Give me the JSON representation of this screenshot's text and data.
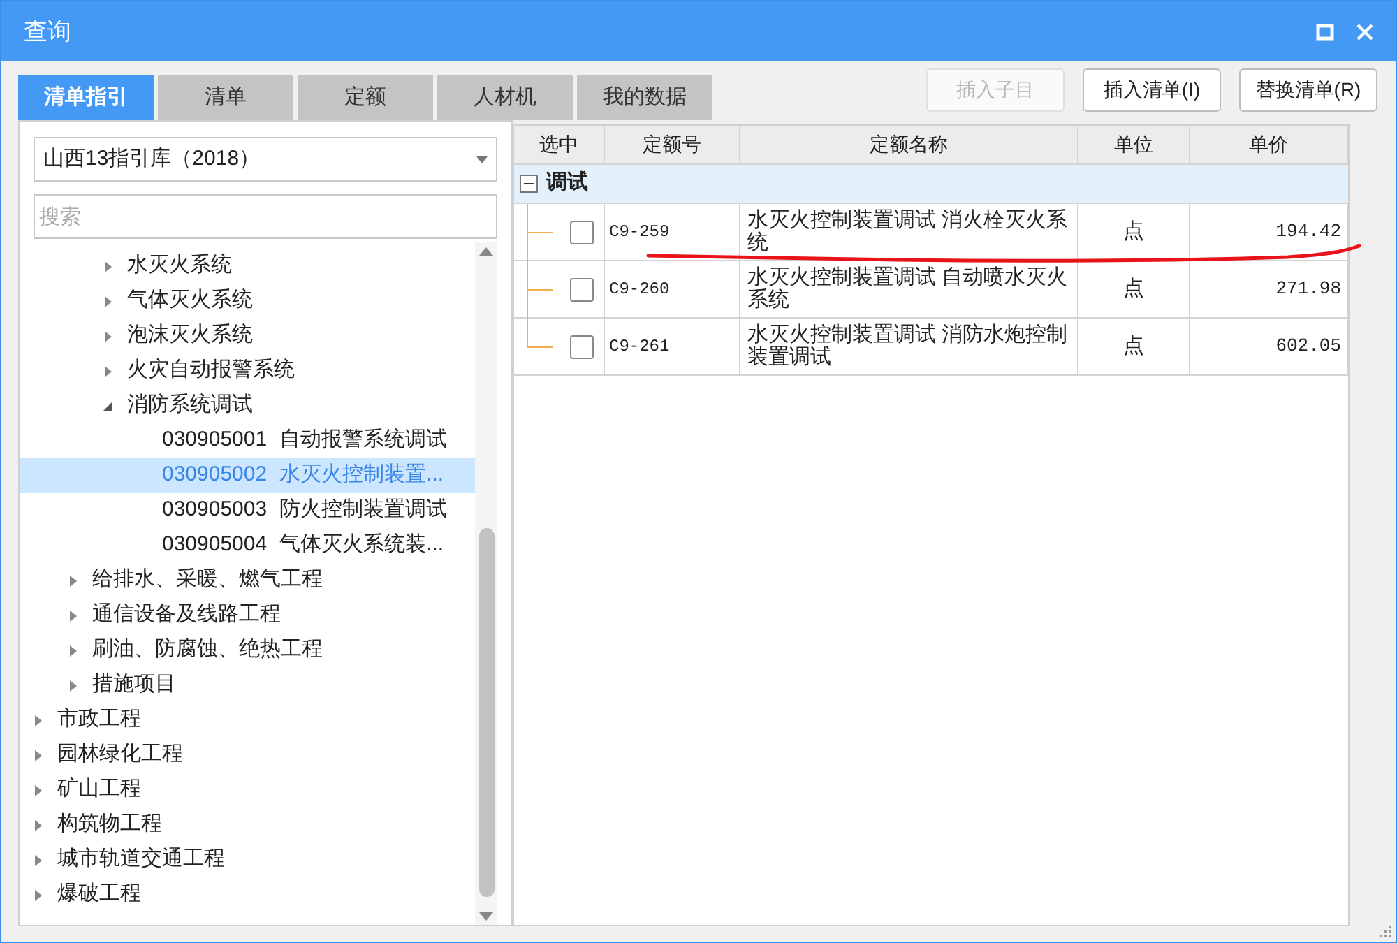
{
  "window": {
    "title": "查询"
  },
  "tabs": [
    {
      "label": "清单指引",
      "selected": true
    },
    {
      "label": "清单",
      "selected": false
    },
    {
      "label": "定额",
      "selected": false
    },
    {
      "label": "人材机",
      "selected": false
    },
    {
      "label": "我的数据",
      "selected": false
    }
  ],
  "buttons": [
    {
      "label": "插入子目",
      "disabled": true
    },
    {
      "label": "插入清单(I)",
      "disabled": false
    },
    {
      "label": "替换清单(R)",
      "disabled": false
    }
  ],
  "library_select": {
    "value": "山西13指引库（2018）"
  },
  "search": {
    "placeholder": "搜索"
  },
  "tree": {
    "items": [
      {
        "children": [
          {
            "children": [
              {
                "label": "水灭火系统",
                "expanded": false,
                "selected": false
              },
              {
                "label": "气体灭火系统",
                "expanded": false,
                "selected": false
              },
              {
                "label": "泡沫灭火系统",
                "expanded": false,
                "selected": false
              },
              {
                "label": "火灾自动报警系统",
                "expanded": false,
                "selected": false
              },
              {
                "label": "消防系统调试",
                "expanded": true,
                "selected": false,
                "children": [
                  {
                    "code": "030905001",
                    "label": "自动报警系统调试",
                    "selected": false
                  },
                  {
                    "code": "030905002",
                    "label": "水灭火控制装置...",
                    "selected": true
                  },
                  {
                    "code": "030905003",
                    "label": "防火控制装置调试",
                    "selected": false
                  },
                  {
                    "code": "030905004",
                    "label": "气体灭火系统装...",
                    "selected": false
                  }
                ]
              }
            ]
          },
          {
            "label": "给排水、采暖、燃气工程",
            "expanded": false,
            "selected": false
          },
          {
            "label": "通信设备及线路工程",
            "expanded": false,
            "selected": false
          },
          {
            "label": "刷油、防腐蚀、绝热工程",
            "expanded": false,
            "selected": false
          },
          {
            "label": "措施项目",
            "expanded": false,
            "selected": false
          }
        ]
      },
      {
        "label": "市政工程",
        "expanded": false,
        "selected": false
      },
      {
        "label": "园林绿化工程",
        "expanded": false,
        "selected": false
      },
      {
        "label": "矿山工程",
        "expanded": false,
        "selected": false
      },
      {
        "label": "构筑物工程",
        "expanded": false,
        "selected": false
      },
      {
        "label": "城市轨道交通工程",
        "expanded": false,
        "selected": false
      },
      {
        "label": "爆破工程",
        "expanded": false,
        "selected": false
      }
    ]
  },
  "table": {
    "columns": [
      "选中",
      "定额号",
      "定额名称",
      "单位",
      "单价"
    ],
    "group": {
      "label": "调试",
      "expanded": true
    },
    "rows": [
      {
        "checked": false,
        "code": "C9-259",
        "name": "水灭火控制装置调试 消火栓灭火系统",
        "unit": "点",
        "price": "194.42"
      },
      {
        "checked": false,
        "code": "C9-260",
        "name": "水灭火控制装置调试 自动喷水灭火系统",
        "unit": "点",
        "price": "271.98"
      },
      {
        "checked": false,
        "code": "C9-261",
        "name": "水灭火控制装置调试 消防水炮控制装置调试",
        "unit": "点",
        "price": "602.05"
      }
    ]
  }
}
